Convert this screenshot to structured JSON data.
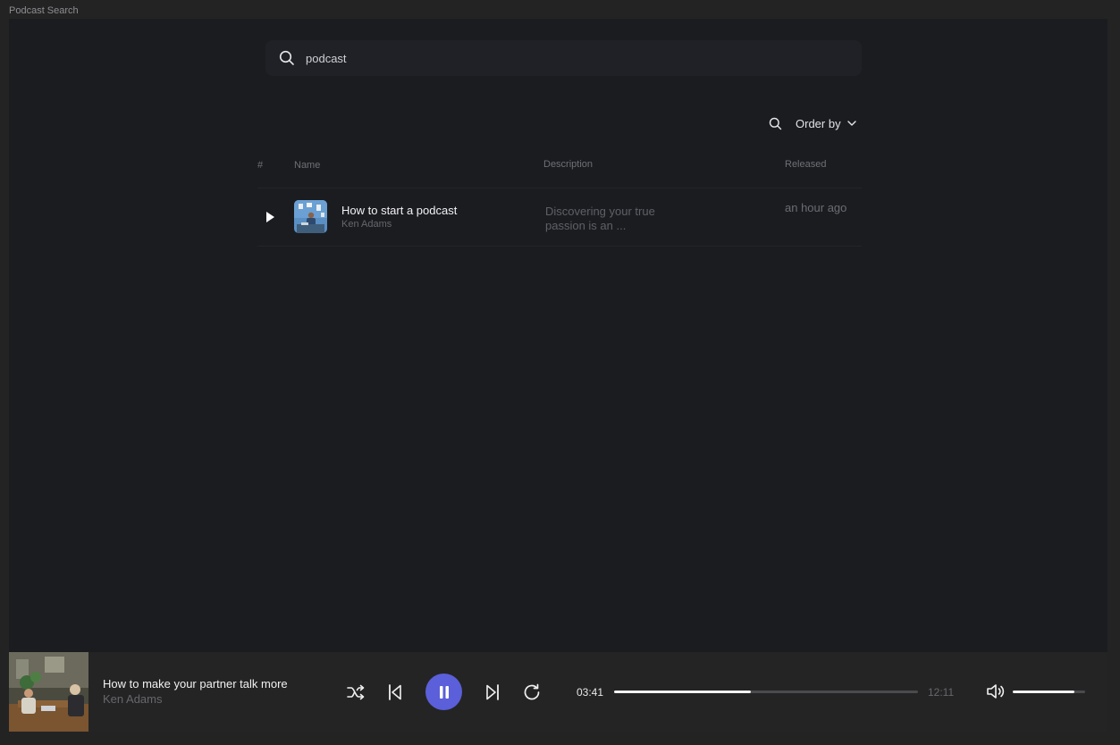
{
  "window": {
    "title": "Podcast Search"
  },
  "search": {
    "value": "podcast"
  },
  "toolbar": {
    "order_label": "Order by"
  },
  "table": {
    "headers": {
      "index": "#",
      "name": "Name",
      "description": "Description",
      "released": "Released"
    },
    "rows": [
      {
        "title": "How to start a podcast",
        "author": "Ken Adams",
        "description": "Discovering your true passion is an ...",
        "released": "an hour ago"
      }
    ]
  },
  "player": {
    "title": "How to make your partner talk more",
    "author": "Ken Adams",
    "current_time": "03:41",
    "total_time": "12:11",
    "progress": 0.45,
    "volume": 0.85,
    "accent_color": "#5b5fd9"
  },
  "icons": [
    "search-icon",
    "chevron-down-icon",
    "play-icon",
    "shuffle-icon",
    "skip-back-icon",
    "pause-icon",
    "skip-forward-icon",
    "repeat-icon",
    "volume-icon"
  ]
}
